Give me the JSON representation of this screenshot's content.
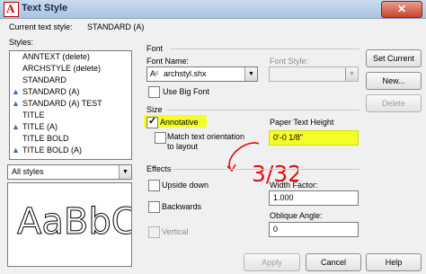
{
  "window": {
    "title": "Text Style",
    "close_glyph": "✕",
    "app_icon_letter": "A"
  },
  "current_style": {
    "label": "Current text style:",
    "value": "STANDARD (A)"
  },
  "styles": {
    "label": "Styles:",
    "items": [
      {
        "label": "ANNTEXT (delete)",
        "annotative": false
      },
      {
        "label": "ARCHSTYLE (delete)",
        "annotative": false
      },
      {
        "label": "STANDARD",
        "annotative": false
      },
      {
        "label": "STANDARD (A)",
        "annotative": true
      },
      {
        "label": "STANDARD (A) TEST",
        "annotative": true
      },
      {
        "label": "TITLE",
        "annotative": false
      },
      {
        "label": "TITLE (A)",
        "annotative": true
      },
      {
        "label": "TITLE BOLD",
        "annotative": false
      },
      {
        "label": "TITLE BOLD (A)",
        "annotative": true
      }
    ],
    "filter": "All styles"
  },
  "preview": {
    "text": "AaBbC"
  },
  "font": {
    "group_label": "Font",
    "name_label": "Font Name:",
    "name_value": "archstyl.shx",
    "style_label": "Font Style:",
    "style_value": "",
    "big_font_label": "Use Big Font"
  },
  "size": {
    "group_label": "Size",
    "annotative_label": "Annotative",
    "match_label_line1": "Match text orientation",
    "match_label_line2": "to layout",
    "paper_height_label": "Paper Text Height",
    "paper_height_value": "0'-0 1/8\""
  },
  "effects": {
    "group_label": "Effects",
    "upside_down_label": "Upside down",
    "backwards_label": "Backwards",
    "vertical_label": "Vertical",
    "width_factor_label": "Width Factor:",
    "width_factor_value": "1.000",
    "oblique_label": "Oblique Angle:",
    "oblique_value": "0"
  },
  "buttons": {
    "set_current": "Set Current",
    "new": "New...",
    "delete": "Delete",
    "apply": "Apply",
    "cancel": "Cancel",
    "help": "Help"
  },
  "annotation": {
    "text": "3/32\"",
    "color": "#e01010"
  },
  "colors": {
    "highlight": "#f4ff2a",
    "annotation_ink": "#e01010"
  }
}
